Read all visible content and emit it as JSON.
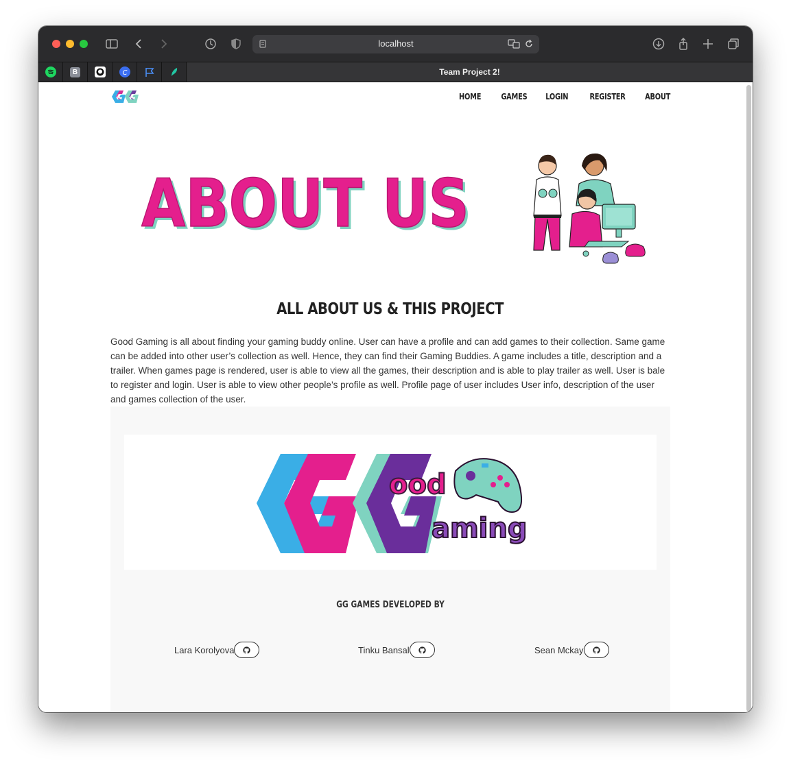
{
  "browser": {
    "url": "localhost",
    "tab_title": "Team Project 2!",
    "pinned_tabs": [
      "spotify-icon",
      "bitwarden-icon",
      "github-icon",
      "copilot-icon",
      "flag-icon",
      "feather-icon"
    ]
  },
  "nav": {
    "links": [
      "HOME",
      "GAMES",
      "LOGIN",
      "REGISTER",
      "ABOUT"
    ]
  },
  "hero": {
    "title": "ABOUT US"
  },
  "section": {
    "title": "ALL ABOUT US & THIS PROJECT",
    "description": "Good Gaming is all about finding your gaming buddy online. User can have a profile and can add games to their collection. Same game can be added into other user’s collection as well. Hence, they can find their Gaming Buddies. A game includes a title, description and a trailer. When games page is rendered, user is able to view all the games, their description and is able to play trailer as well. User is bale to register and login. User is able to view other people’s profile as well. Profile page of user includes User info, description of the user and games collection of the user."
  },
  "logo": {
    "line1": "ood",
    "line2": "aming"
  },
  "credits": {
    "title": "GG GAMES DEVELOPED BY",
    "developers": [
      "Lara Korolyova",
      "Tinku Bansal",
      "Sean Mckay"
    ]
  },
  "colors": {
    "pink": "#e41f8d",
    "teal": "#7fd3c0",
    "purple": "#6a2e9b",
    "blue": "#3aaee6"
  }
}
